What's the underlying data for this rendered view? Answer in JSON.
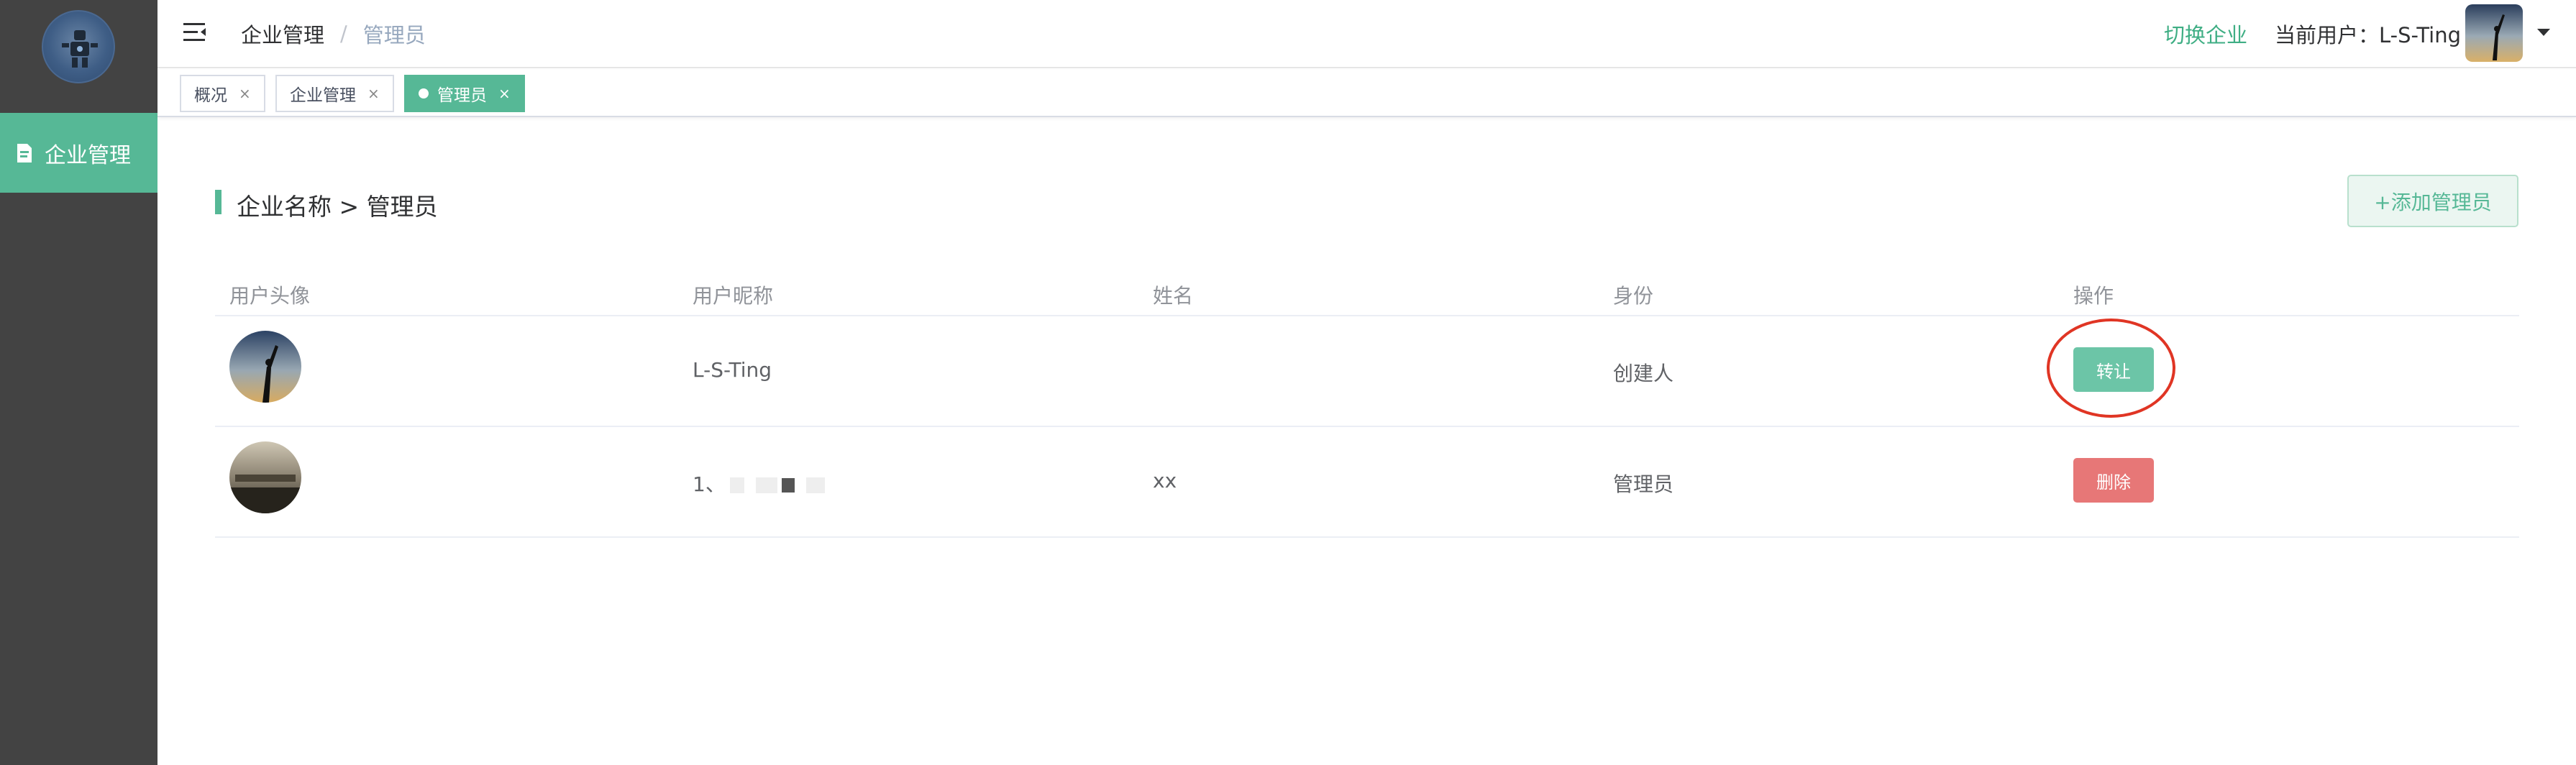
{
  "sidebar": {
    "menu": [
      {
        "label": "企业管理",
        "icon": "document-icon",
        "active": true
      }
    ]
  },
  "header": {
    "breadcrumb": [
      "企业管理",
      "管理员"
    ],
    "separator": "/",
    "switch_label": "切换企业",
    "current_user_prefix": "当前用户：",
    "current_user": "L-S-Ting"
  },
  "tags": [
    {
      "label": "概况",
      "close": "×",
      "active": false
    },
    {
      "label": "企业管理",
      "close": "×",
      "active": false
    },
    {
      "label": "管理员",
      "close": "×",
      "active": true
    }
  ],
  "main": {
    "section_title": "企业名称 > 管理员",
    "add_button": "+添加管理员",
    "columns": [
      "用户头像",
      "用户昵称",
      "姓名",
      "身份",
      "操作"
    ],
    "rows": [
      {
        "nickname": "L-S-Ting",
        "name": "",
        "role": "创建人",
        "action": "转让"
      },
      {
        "nickname": "1、",
        "name": "xx",
        "role": "管理员",
        "action": "删除"
      }
    ]
  },
  "colors": {
    "sidebar_bg": "#434343",
    "accent": "#56b896",
    "transfer_button": "#6cc5a7",
    "delete_button": "#e77777",
    "highlight_circle": "#e03524"
  }
}
